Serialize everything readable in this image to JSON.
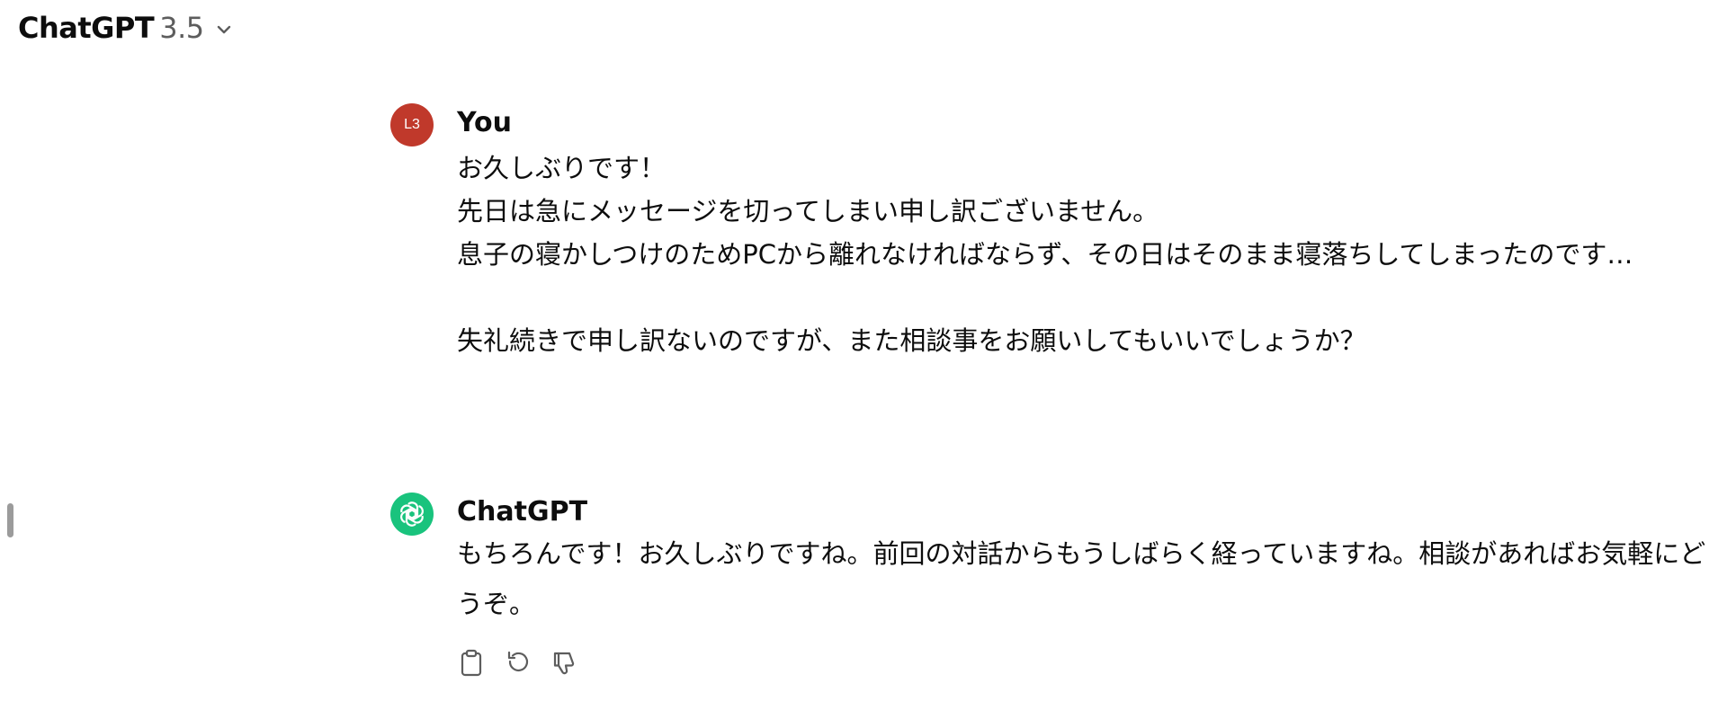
{
  "header": {
    "model_name": "ChatGPT",
    "model_version": "3.5",
    "dropdown_icon": "chevron-down-icon"
  },
  "messages": [
    {
      "role": "user",
      "author": "You",
      "avatar_initials": "L3",
      "avatar_color": "#c0392b",
      "text": "お久しぶりです！\n先日は急にメッセージを切ってしまい申し訳ございません。\n息子の寝かしつけのためPCから離れなければならず、その日はそのまま寝落ちしてしまったのです…\n\n失礼続きで申し訳ないのですが、また相談事をお願いしてもいいでしょうか？"
    },
    {
      "role": "assistant",
      "author": "ChatGPT",
      "avatar_icon": "openai-logo-icon",
      "avatar_color": "#19c37d",
      "text": "もちろんです！お久しぶりですね。前回の対話からもうしばらく経っていますね。相談があればお気軽にどうぞ。",
      "actions": [
        "copy-icon",
        "regenerate-icon",
        "thumbs-down-icon"
      ]
    }
  ]
}
